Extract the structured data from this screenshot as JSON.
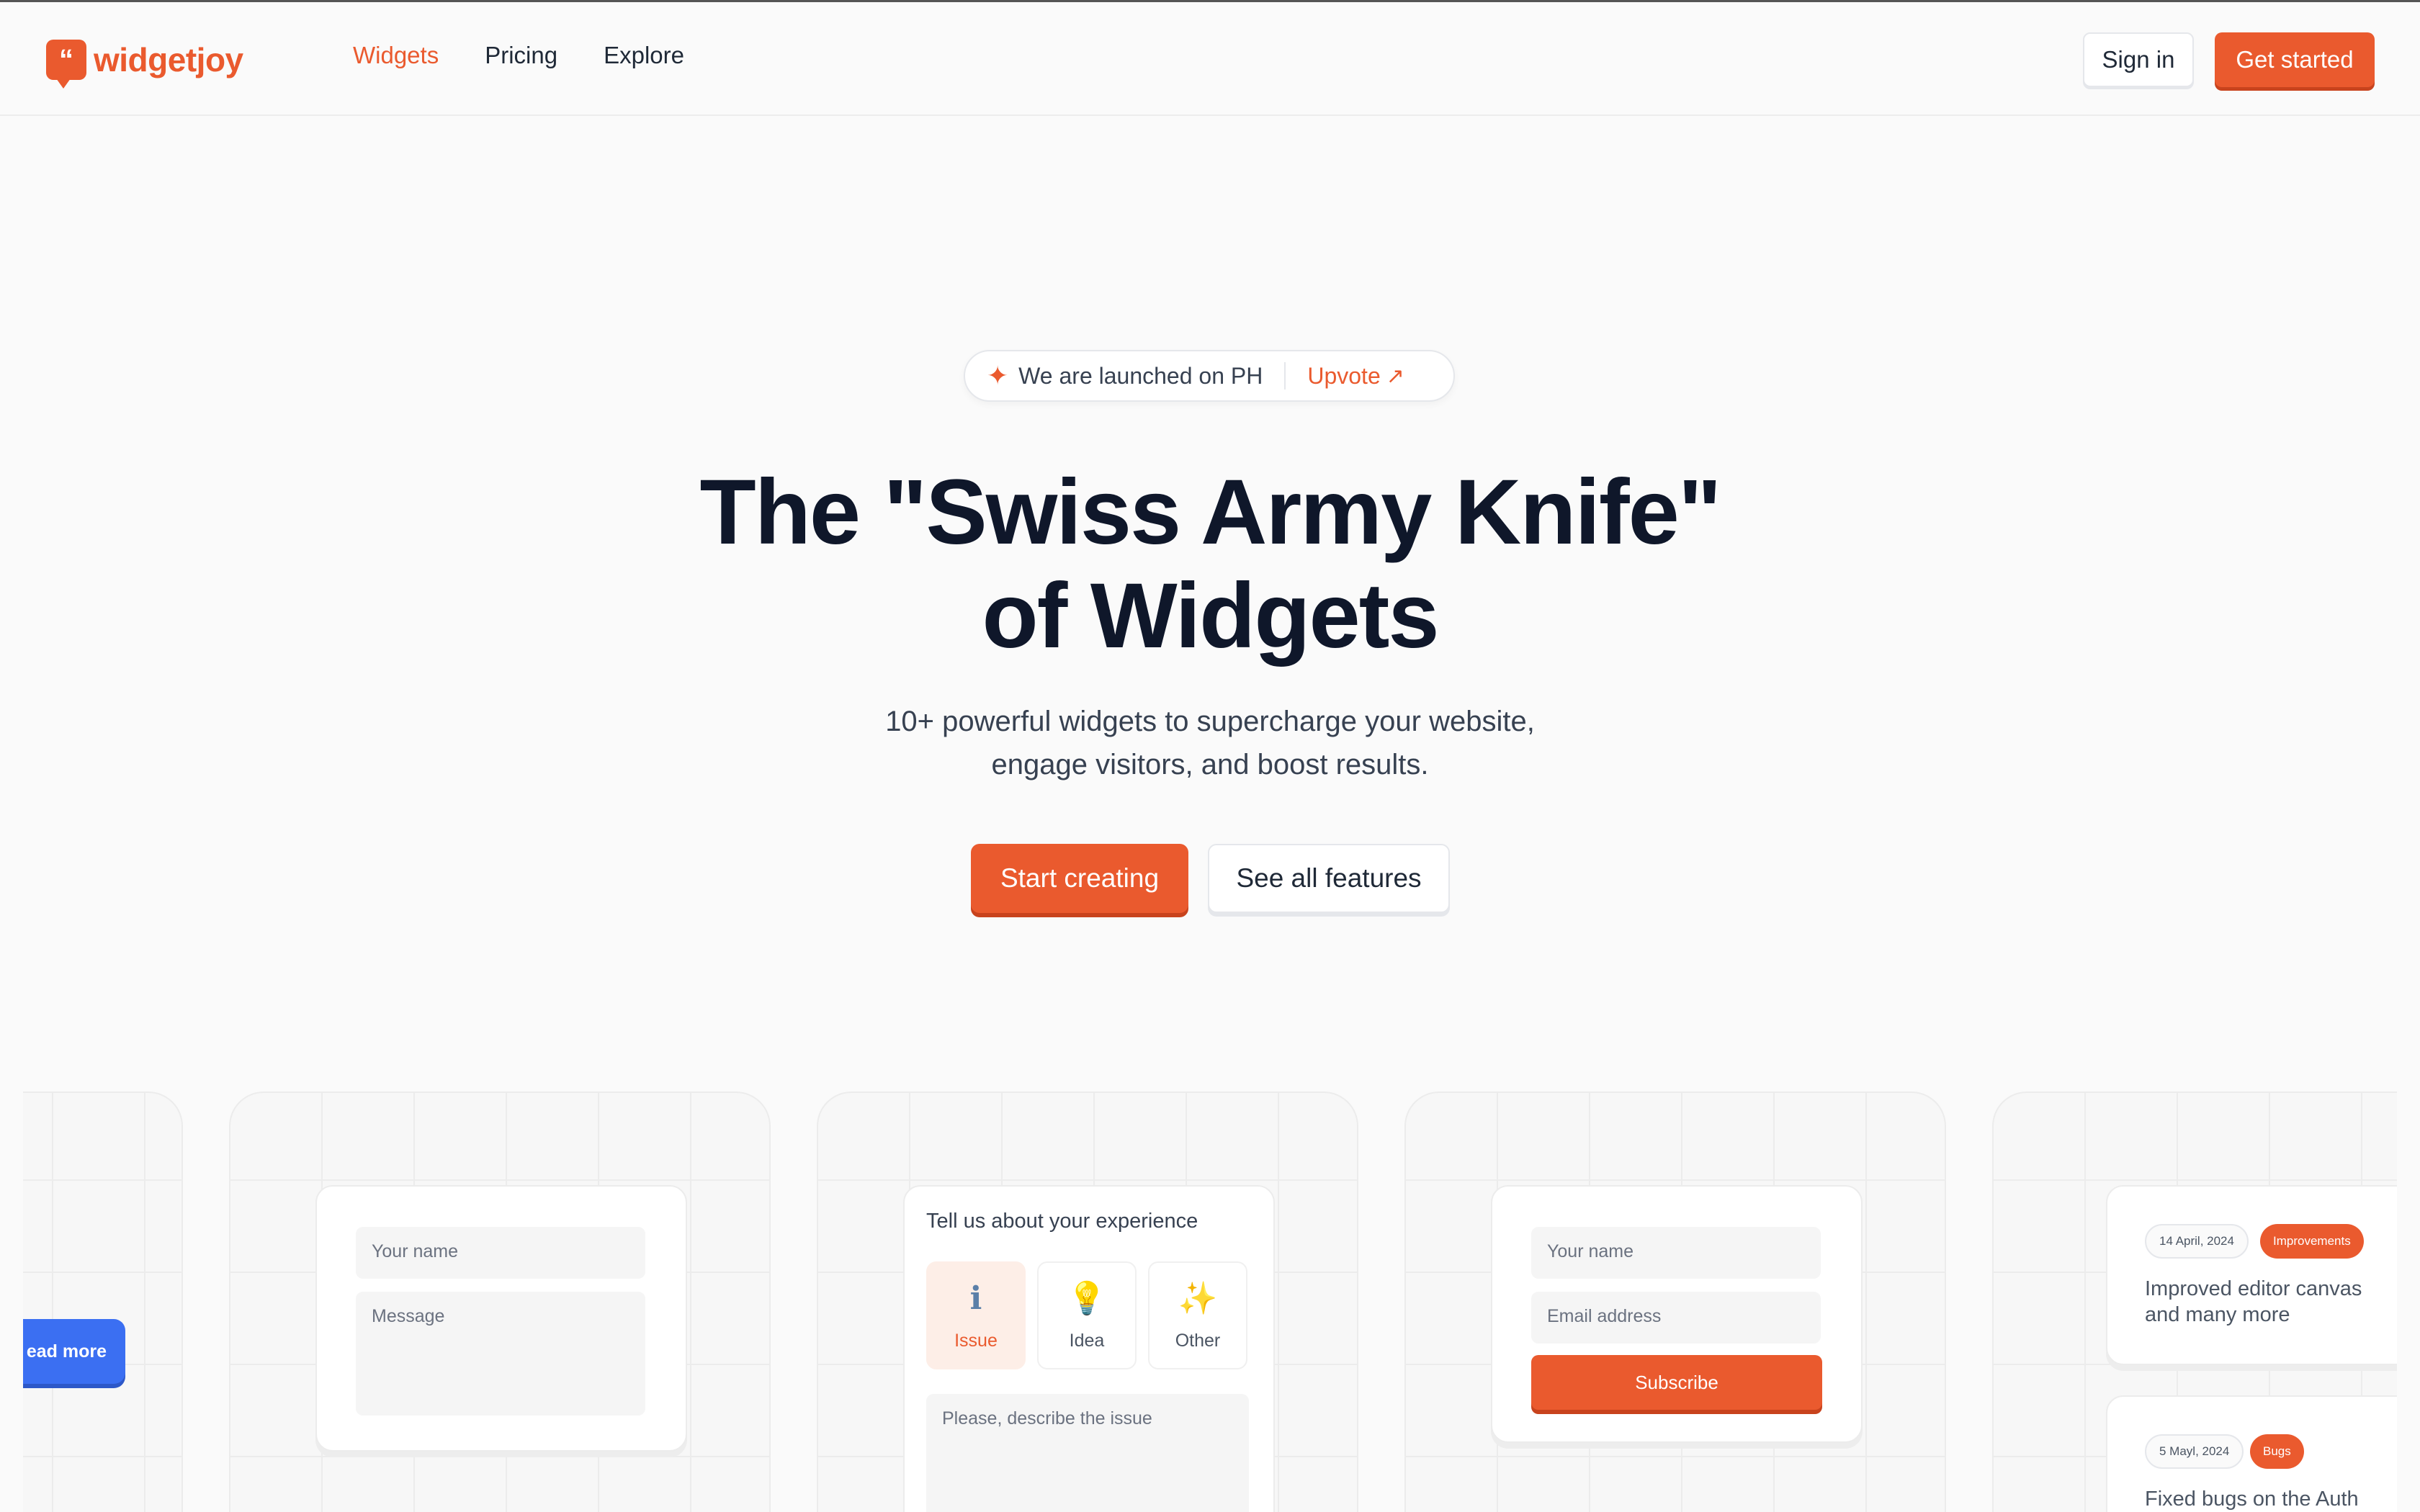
{
  "header": {
    "brand": "widgetjoy",
    "logo_mark": "“",
    "nav": [
      {
        "label": "Widgets",
        "active": true
      },
      {
        "label": "Pricing",
        "active": false
      },
      {
        "label": "Explore",
        "active": false
      }
    ],
    "sign_in_label": "Sign in",
    "get_started_label": "Get started"
  },
  "hero": {
    "announcement": {
      "icon": "sparkle-icon",
      "text": "We are launched on PH",
      "link_label": "Upvote",
      "link_icon": "arrow-up-right-icon"
    },
    "title_line1": "The \"Swiss Army Knife\"",
    "title_line2": "of Widgets",
    "subtitle_line1": "10+ powerful widgets to supercharge your website,",
    "subtitle_line2": "engage visitors, and boost results.",
    "primary_cta": "Start creating",
    "secondary_cta": "See all features"
  },
  "showcase": {
    "announcement_widget": {
      "button_label": "ead more"
    },
    "contact_widget": {
      "name_placeholder": "Your name",
      "message_placeholder": "Message"
    },
    "feedback_widget": {
      "title": "Tell us about your experience",
      "options": [
        {
          "icon": "info-icon",
          "glyph": "ℹ",
          "label": "Issue",
          "selected": true
        },
        {
          "icon": "lightbulb-icon",
          "glyph": "💡",
          "label": "Idea",
          "selected": false
        },
        {
          "icon": "sparkles-icon",
          "glyph": "✨",
          "label": "Other",
          "selected": false
        }
      ],
      "describe_placeholder": "Please, describe the issue"
    },
    "newsletter_widget": {
      "name_placeholder": "Your name",
      "email_placeholder": "Email address",
      "subscribe_label": "Subscribe"
    },
    "changelog_widget": {
      "entries": [
        {
          "date": "14 April, 2024",
          "tag": "Improvements",
          "text": "Improved editor canvas and many more"
        },
        {
          "date": "5 Mayl, 2024",
          "tag": "Bugs",
          "text": "Fixed bugs on the Auth"
        }
      ]
    }
  },
  "colors": {
    "brand": "#ea5a2e",
    "blue": "#3b6ff2",
    "text_dark": "#0f172a"
  }
}
